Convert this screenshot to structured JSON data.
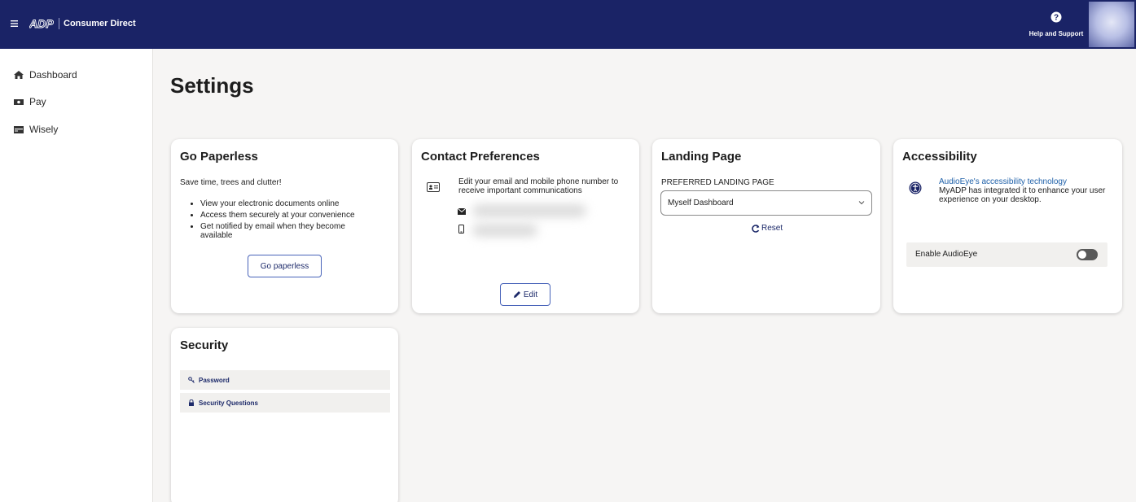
{
  "header": {
    "app_name": "Consumer Direct",
    "help_label": "Help and Support",
    "icons": [
      "menu-icon",
      "adp-logo",
      "help-icon",
      "avatar"
    ],
    "colors": {
      "bar": "#1a2366",
      "accent": "#4863b9"
    }
  },
  "sidebar": {
    "items": [
      {
        "label": "Dashboard",
        "icon": "home-icon"
      },
      {
        "label": "Pay",
        "icon": "money-icon"
      },
      {
        "label": "Wisely",
        "icon": "card-icon"
      }
    ]
  },
  "page": {
    "title": "Settings"
  },
  "paperless": {
    "title": "Go Paperless",
    "intro": "Save time, trees and clutter!",
    "bullets": [
      "View your electronic documents online",
      "Access them securely at your convenience",
      "Get notified by email when they become available"
    ],
    "button": "Go paperless"
  },
  "contact": {
    "title": "Contact Preferences",
    "description": "Edit your email and mobile phone number to receive important communications",
    "edit_button": "Edit",
    "icons": [
      "contact-card-icon",
      "envelope-icon",
      "mobile-phone-icon",
      "pencil-icon"
    ]
  },
  "landing": {
    "title": "Landing Page",
    "field_label": "PREFERRED LANDING PAGE",
    "selected": "Myself Dashboard",
    "reset": "Reset"
  },
  "accessibility": {
    "title": "Accessibility",
    "link": "AudioEye's accessibility technology",
    "description": "MyADP has integrated it to enhance your user experience on your desktop.",
    "toggle_label": "Enable AudioEye",
    "toggle_on": false
  },
  "security": {
    "title": "Security",
    "items": [
      {
        "label": "Password",
        "icon": "key-icon"
      },
      {
        "label": "Security Questions",
        "icon": "lock-icon"
      }
    ]
  }
}
